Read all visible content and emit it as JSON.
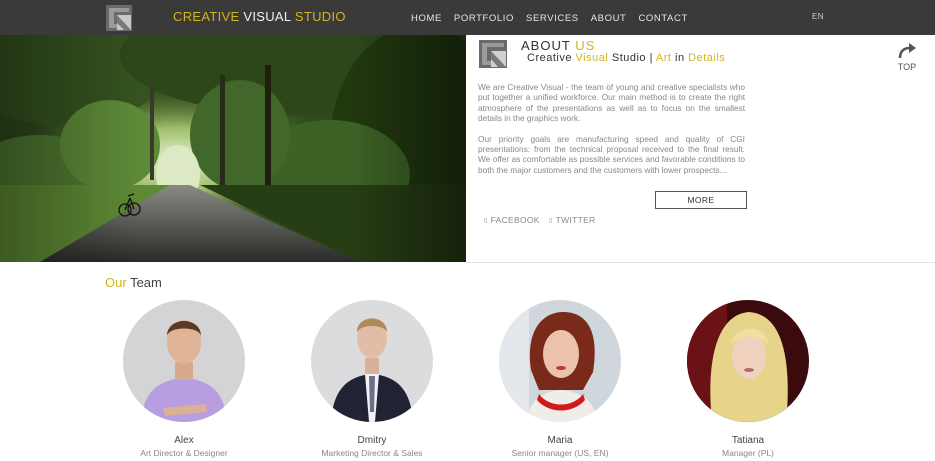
{
  "header": {
    "brand": {
      "part1": "CREATIVE",
      "part2": "VISUAL",
      "part3": "STUDIO"
    },
    "nav": [
      "HOME",
      "PORTFOLIO",
      "SERVICES",
      "ABOUT",
      "CONTACT"
    ],
    "lang": "EN"
  },
  "about": {
    "title_a": "ABOUT",
    "title_b": "US",
    "sub_creative": "Creative",
    "sub_visual": "Visual",
    "sub_studio": "Studio |",
    "sub_art": "Art",
    "sub_in": "in",
    "sub_details": "Details",
    "top_label": "TOP",
    "paragraph1": "We are Creative Visual - the team of young and creative specialists who put together a unified workforce. Our main method is to create the right atmosphere of the presentations as well as to focus on the smallest details in the graphics work.",
    "paragraph2": "Our priority goals are manufacturing speed and quality of CGI presentations: from the technical proposal received to the final result. We offer as comfortable as possible services and favorable conditions to both the major customers and the customers with lower prospects...",
    "more_label": "MORE",
    "facebook_label": "FACEBOOK",
    "twitter_label": "TWITTER",
    "social_icon": "▯"
  },
  "team": {
    "title_a": "Our",
    "title_b": "Team",
    "members": [
      {
        "name": "Alex",
        "role": "Art Director & Designer"
      },
      {
        "name": "Dmitry",
        "role": "Marketing Director & Sales"
      },
      {
        "name": "Maria",
        "role": "Senior manager (US, EN)"
      },
      {
        "name": "Tatiana",
        "role": "Manager (PL)"
      }
    ]
  },
  "colors": {
    "accent": "#d4b51a",
    "header_bg": "#3a3a3a"
  }
}
